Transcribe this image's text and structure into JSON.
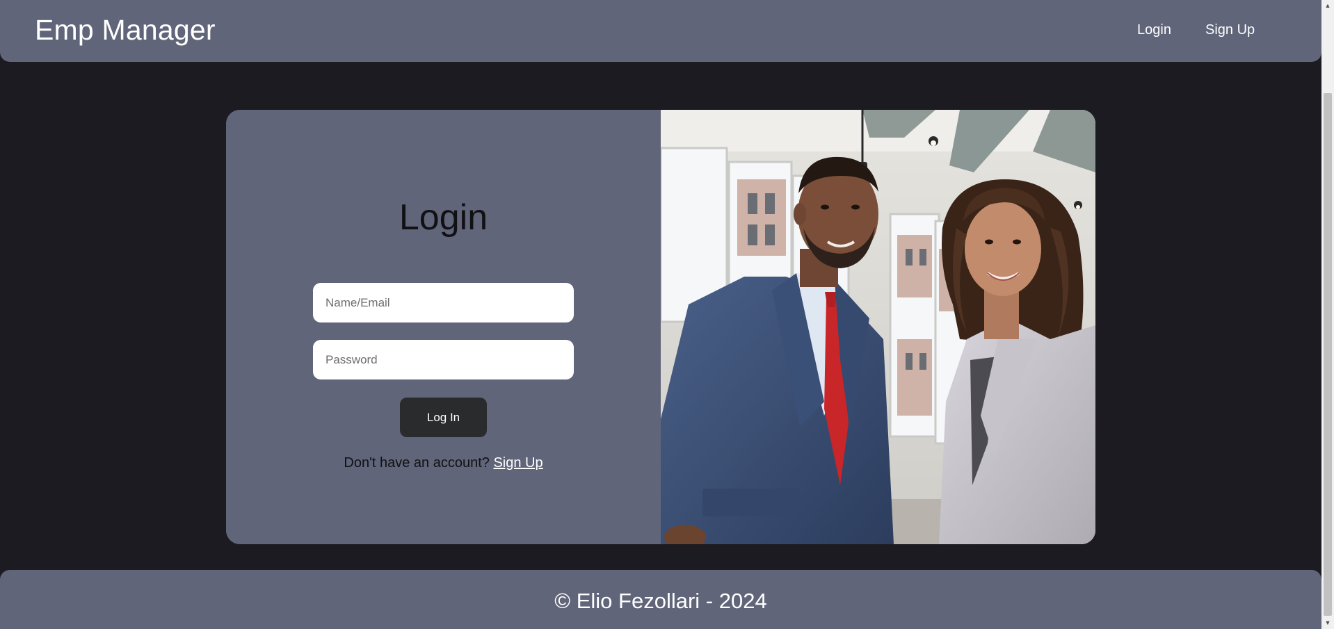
{
  "navbar": {
    "brand": "Emp Manager",
    "links": [
      {
        "label": "Login"
      },
      {
        "label": "Sign Up"
      }
    ]
  },
  "login_form": {
    "title": "Login",
    "name_placeholder": "Name/Email",
    "password_placeholder": "Password",
    "submit_label": "Log In",
    "signup_prompt": "Don't have an account?",
    "signup_link": "Sign Up"
  },
  "footer": {
    "text": "© Elio Fezollari - 2024"
  },
  "colors": {
    "page_bg": "#1c1b21",
    "panel": "#60657a",
    "button": "#2a2b2d"
  },
  "icons": {
    "scroll_up": "scroll-up-arrow-icon",
    "scroll_down": "scroll-down-arrow-icon"
  }
}
